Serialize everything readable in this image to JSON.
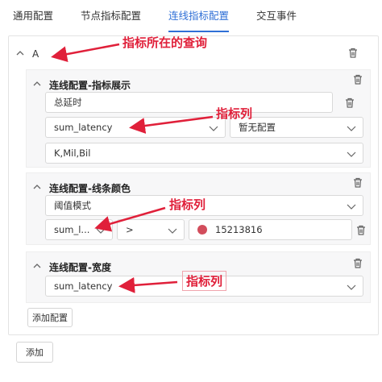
{
  "tabs": [
    {
      "label": "通用配置",
      "active": false
    },
    {
      "label": "节点指标配置",
      "active": false
    },
    {
      "label": "连线指标配置",
      "active": true
    },
    {
      "label": "交互事件",
      "active": false
    }
  ],
  "group": {
    "label": "A"
  },
  "sections": {
    "display": {
      "title": "连线配置-指标展示",
      "name_value": "总延时",
      "metric_value": "sum_latency",
      "config_value": "暂无配置",
      "units_value": "K,Mil,Bil"
    },
    "color": {
      "title": "连线配置-线条颜色",
      "mode_value": "阈值模式",
      "metric_value": "sum_l...",
      "operator_value": ">",
      "color_value": "15213816",
      "color_hex": "#d24d5c"
    },
    "width": {
      "title": "连线配置-宽度",
      "metric_value": "sum_latency"
    }
  },
  "buttons": {
    "add_config": "添加配置",
    "add": "添加"
  },
  "annotations": {
    "query": "指标所在的查询",
    "metric1": "指标列",
    "metric2": "指标列",
    "metric3": "指标列",
    "color": "#e0203a"
  },
  "icons": {
    "chevron": "chevron-up-icon",
    "trash": "trash-icon",
    "caret": "chevron-down-icon"
  }
}
